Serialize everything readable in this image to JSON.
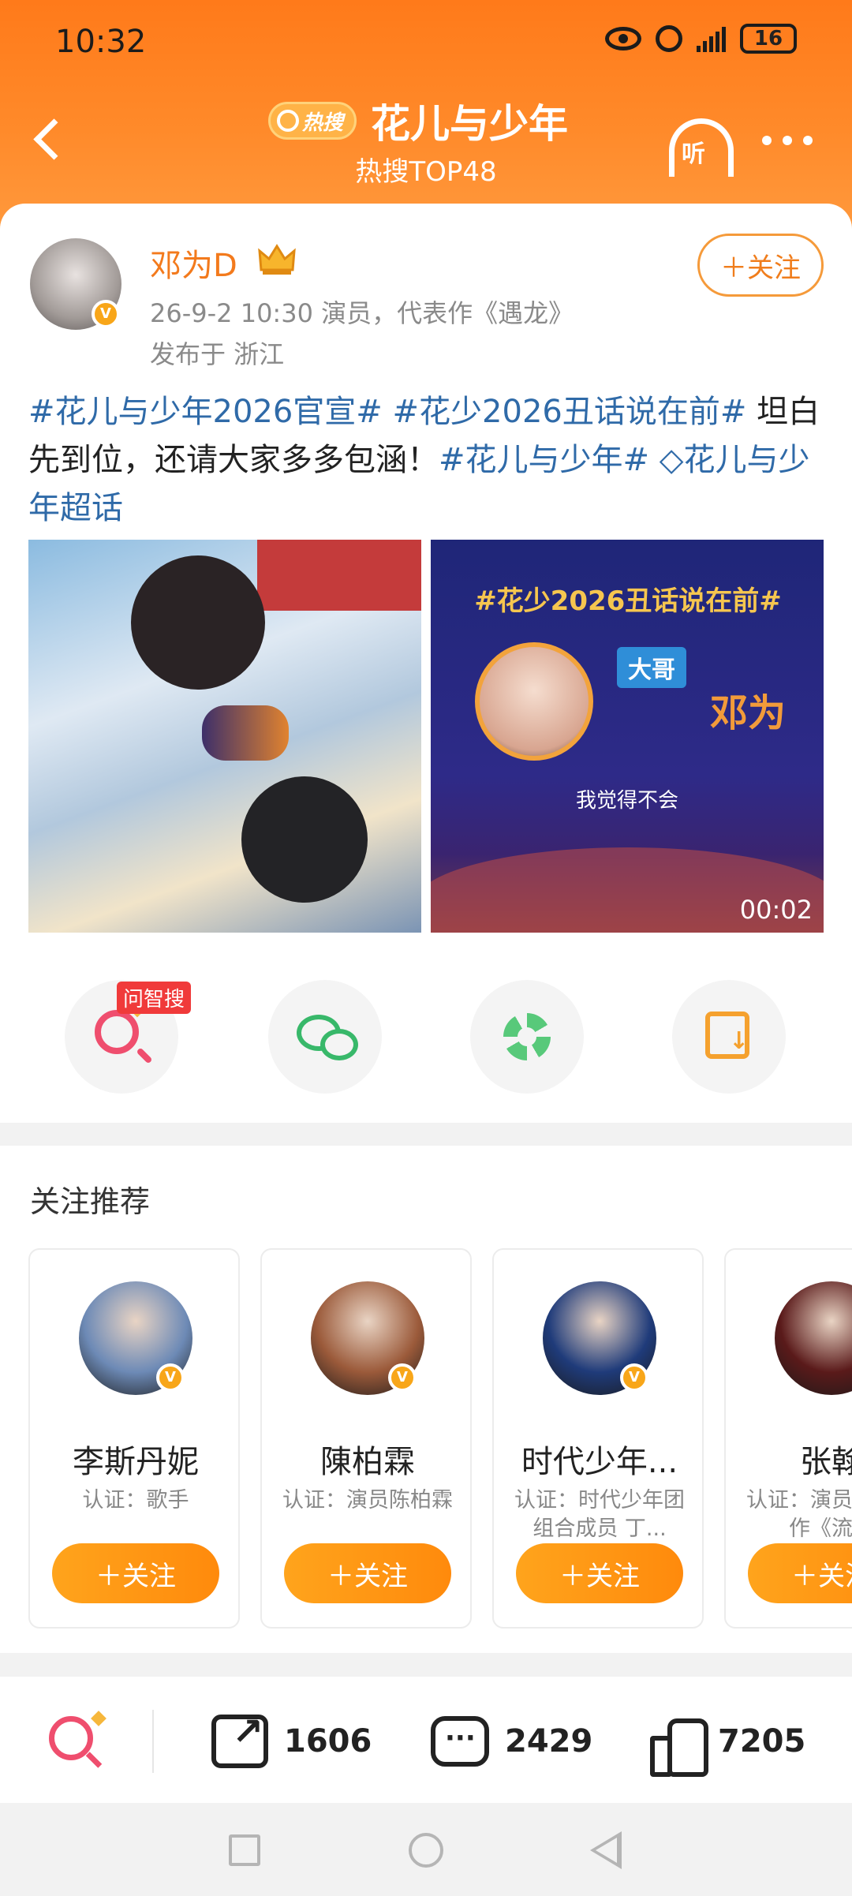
{
  "status_bar": {
    "time": "10:32",
    "battery": "16"
  },
  "header": {
    "badge_label": "热搜",
    "title": "花儿与少年",
    "subtitle": "热搜TOP48",
    "listen_label": "听"
  },
  "post": {
    "author": "邓为D",
    "meta": "26-9-2 10:30   演员，代表作《遇龙》",
    "location": "发布于 浙江",
    "follow_label": "＋关注",
    "text_parts": [
      {
        "text": "#花儿与少年2026官宣#",
        "tag": true
      },
      {
        "text": " ",
        "tag": false
      },
      {
        "text": "#花少2026丑话说在前#",
        "tag": true
      },
      {
        "text": " 坦白先到位，还请大家多多包涵！",
        "tag": false
      },
      {
        "text": "#花儿与少年#",
        "tag": true
      },
      {
        "text": " ",
        "tag": false
      },
      {
        "text": "◇花儿与少年超话",
        "tag": true
      }
    ],
    "video": {
      "title": "#花少2026丑话说在前#",
      "tag": "大哥",
      "name": "邓为",
      "quote": "我觉得不会",
      "duration": "00:02"
    }
  },
  "actions": {
    "ai_badge": "问智搜",
    "items": [
      {
        "name": "ai-search-icon"
      },
      {
        "name": "wechat-icon"
      },
      {
        "name": "moments-icon"
      },
      {
        "name": "save-image-icon"
      }
    ]
  },
  "recommend": {
    "title": "关注推荐",
    "follow_label": "＋关注",
    "cards": [
      {
        "name": "李斯丹妮",
        "desc": "认证：歌手",
        "avatar_color": "#6d8ab6"
      },
      {
        "name": "陳柏霖",
        "desc": "认证：演员陈柏霖",
        "avatar_color": "#9b5a3a"
      },
      {
        "name": "时代少年...",
        "desc": "认证：时代少年团组合成员 丁...",
        "avatar_color": "#1f3b7a"
      },
      {
        "name": "张翰",
        "desc": "认证：演员，代表作《流星",
        "avatar_color": "#5a1a1a"
      }
    ]
  },
  "bottom_bar": {
    "share_count": "1606",
    "comment_count": "2429",
    "like_count": "7205"
  },
  "colors": {
    "brand_orange": "#ff8a2a",
    "tag_blue": "#2f6aa8",
    "follow_gradient_start": "#ffa41c"
  }
}
